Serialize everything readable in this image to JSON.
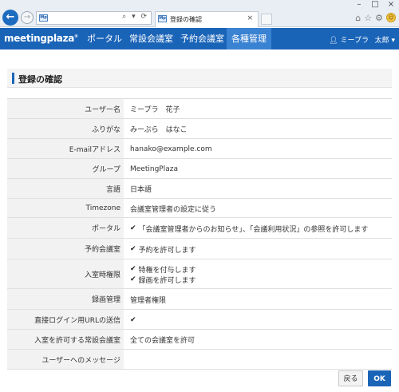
{
  "browser": {
    "address_fav": "Mp",
    "tab_title": "登録の確認",
    "tab_fav": "Mp",
    "addr_icons": "⌕ ▾ ⟳",
    "tab_close": "×",
    "window_controls": [
      "–",
      "□",
      "×"
    ],
    "toolbar_icons": [
      "⌂",
      "☆",
      "⚙"
    ],
    "smiley": "☺"
  },
  "appbar": {
    "logo": "meetingplaza",
    "logo_reg": "®",
    "nav": [
      "ポータル",
      "常設会議室",
      "予約会議室",
      "各種管理"
    ],
    "active_index": 3,
    "user_name": "ミープラ",
    "user_menu": "太郎"
  },
  "page": {
    "title": "登録の確認"
  },
  "rows": [
    {
      "label": "ユーザー名",
      "value": [
        "ミープラ　花子"
      ],
      "checks": false,
      "h": 25
    },
    {
      "label": "ふりがな",
      "value": [
        "みーぷら　はなこ"
      ],
      "checks": false,
      "h": 25
    },
    {
      "label": "E-mailアドレス",
      "value": [
        "hanako@example.com"
      ],
      "checks": false,
      "h": 25
    },
    {
      "label": "グループ",
      "value": [
        "MeetingPlaza"
      ],
      "checks": false,
      "h": 25
    },
    {
      "label": "言語",
      "value": [
        "日本語"
      ],
      "checks": false,
      "h": 25
    },
    {
      "label": "Timezone",
      "value": [
        "会議室管理者の設定に従う"
      ],
      "checks": false,
      "h": 24
    },
    {
      "label": "ポータル",
      "value": [
        "「会議室管理者からのお知らせ」、「会議利用状況」の参照を許可します"
      ],
      "checks": true,
      "h": 26
    },
    {
      "label": "予約会議室",
      "value": [
        "予約を許可します"
      ],
      "checks": true,
      "h": 26
    },
    {
      "label": "入室時権限",
      "value": [
        "特権を付与します",
        "録画を許可します"
      ],
      "checks": true,
      "h": 37
    },
    {
      "label": "録画管理",
      "value": [
        "管理者権限"
      ],
      "checks": false,
      "h": 26
    },
    {
      "label": "直接ログイン用URLの送信",
      "value": [
        ""
      ],
      "checks": true,
      "h": 25
    },
    {
      "label": "入室を許可する常設会議室",
      "value": [
        "全ての会議室を許可"
      ],
      "checks": false,
      "h": 25
    },
    {
      "label": "ユーザーへのメッセージ",
      "value": [
        ""
      ],
      "checks": false,
      "h": 25
    }
  ],
  "buttons": {
    "back": "戻る",
    "ok": "OK"
  },
  "colors": {
    "brand": "#1a64b8",
    "active_nav": "#3a82d2"
  }
}
